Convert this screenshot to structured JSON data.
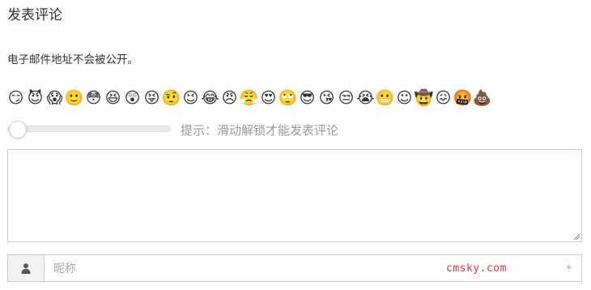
{
  "comment_form": {
    "title": "发表评论",
    "notice": "电子邮件地址不会被公开。",
    "emojis": [
      {
        "name": "smirk-emoji",
        "glyph": "😏"
      },
      {
        "name": "imp-emoji",
        "glyph": "😈"
      },
      {
        "name": "scream-emoji",
        "glyph": "😱"
      },
      {
        "name": "slight-smile-emoji",
        "glyph": "🙂"
      },
      {
        "name": "flushed-emoji",
        "glyph": "😳"
      },
      {
        "name": "laughing-emoji",
        "glyph": "😆"
      },
      {
        "name": "astonished-emoji",
        "glyph": "😲"
      },
      {
        "name": "tongue-wink-emoji",
        "glyph": "😝"
      },
      {
        "name": "raised-eyebrow-emoji",
        "glyph": "🤨"
      },
      {
        "name": "wink-emoji",
        "glyph": "😉"
      },
      {
        "name": "joy-emoji",
        "glyph": "😂"
      },
      {
        "name": "angry-emoji",
        "glyph": "😠"
      },
      {
        "name": "triumph-emoji",
        "glyph": "😤"
      },
      {
        "name": "heart-eyes-emoji",
        "glyph": "😍"
      },
      {
        "name": "rolling-eyes-emoji",
        "glyph": "🙄"
      },
      {
        "name": "sunglasses-emoji",
        "glyph": "😎"
      },
      {
        "name": "kissing-heart-emoji",
        "glyph": "😘"
      },
      {
        "name": "unamused-emoji",
        "glyph": "😒"
      },
      {
        "name": "sob-emoji",
        "glyph": "😭"
      },
      {
        "name": "grimacing-emoji",
        "glyph": "😬"
      },
      {
        "name": "relieved-emoji",
        "glyph": "☺"
      },
      {
        "name": "cowboy-emoji",
        "glyph": "🤠"
      },
      {
        "name": "confounded-emoji",
        "glyph": "😖"
      },
      {
        "name": "cursing-emoji",
        "glyph": "🤬"
      },
      {
        "name": "poop-emoji",
        "glyph": "💩"
      }
    ],
    "slider_hint": "提示：滑动解锁才能发表评论",
    "slider_progress": 0,
    "comment_value": "",
    "name_placeholder": "昵称",
    "watermark": "cmsky.com",
    "required_mark": "*"
  },
  "icons": {
    "user_icon": "user-icon"
  },
  "colors": {
    "watermark": "#e03a3a",
    "border": "#cccccc",
    "hint": "#999999"
  }
}
